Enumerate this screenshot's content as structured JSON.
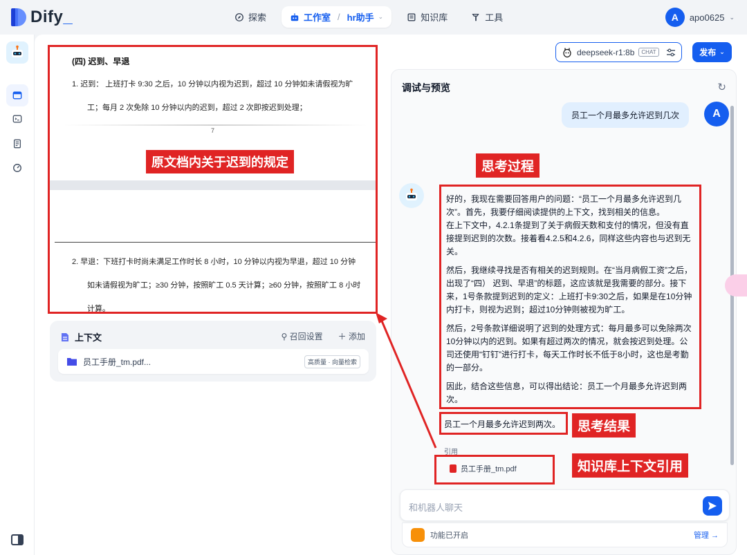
{
  "brand": {
    "logo": "Dify"
  },
  "nav": {
    "explore": "探索",
    "studio": "工作室",
    "app": "hr助手",
    "knowledge": "知识库",
    "tools": "工具"
  },
  "user": {
    "initial": "A",
    "name": "apo0625"
  },
  "doc": {
    "heading": "(四) 迟到、早退",
    "line1": "1.    迟到：  上班打卡 9:30 之后，10 分钟以内视为迟到，超过 10 分钟如未请假视为旷",
    "line2": "工；每月 2 次免除 10 分钟以内的迟到，超过 2 次即按迟到处理；",
    "page_num": "7",
    "line3": "2.    早退：下班打卡时尚未满足工作时长 8 小时，10 分钟以内视为早退，超过 10 分钟",
    "line4": "如未请假视为旷工；≥30 分钟，按照旷工 0.5 天计算；≥60 分钟，按照旷工 8 小时",
    "line5": "计算。"
  },
  "annotations": {
    "doc_rule": "原文档内关于迟到的规定",
    "thinking": "思考过程",
    "result": "思考结果",
    "citation": "知识库上下文引用"
  },
  "context": {
    "title": "上下文",
    "recall": "召回设置",
    "add": "添加",
    "file": "员工手册_tm.pdf...",
    "tag": "高质量 · 向量检索"
  },
  "model": {
    "name": "deepseek-r1:8b",
    "mode": "CHAT"
  },
  "publish": "发布",
  "debug": {
    "title": "调试与预览",
    "question": "员工一个月最多允许迟到几次",
    "think_p1": "好的，我现在需要回答用户的问题：“员工一个月最多允许迟到几次”。首先，我要仔细阅读提供的上下文，找到相关的信息。",
    "think_p1b": "在上下文中，4.2.1条提到了关于病假天数和支付的情况，但没有直接提到迟到的次数。接着看4.2.5和4.2.6，同样这些内容也与迟到无关。",
    "think_p2": "然后，我继续寻找是否有相关的迟到规则。在“当月病假工资”之后，出现了“四） 迟到、早退”的标题，这应该就是我需要的部分。接下来，1号条款提到迟到的定义：上班打卡9:30之后，如果是在10分钟内打卡，则视为迟到；超过10分钟则被视为旷工。",
    "think_p3": "然后，2号条款详细说明了迟到的处理方式：每月最多可以免除两次10分钟以内的迟到。如果有超过两次的情况，就会按迟到处理。公司还使用“钉钉”进行打卡，每天工作时长不低于8小时，这也是考勤的一部分。",
    "think_p4": "因此，结合这些信息，可以得出结论：员工一个月最多允许迟到两次。",
    "answer": "员工一个月最多允许迟到两次。",
    "cite_label": "引用",
    "cite_file": "员工手册_tm.pdf",
    "input_placeholder": "和机器人聊天",
    "feature_text": "功能已开启",
    "manage": "管理 →"
  },
  "colors": {
    "accent": "#155eef",
    "annotation": "#e02424"
  }
}
